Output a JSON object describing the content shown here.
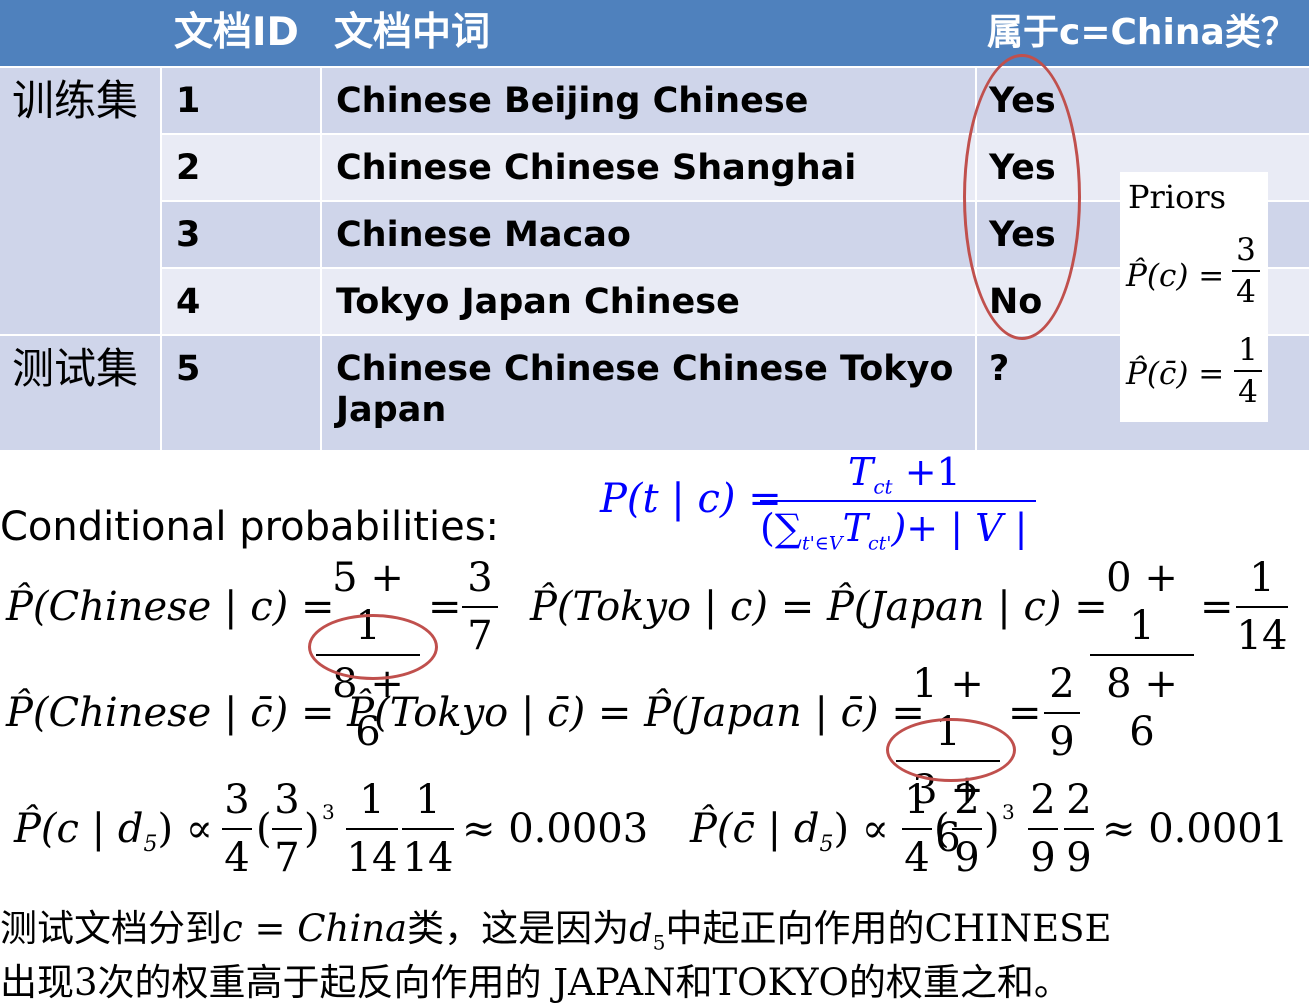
{
  "table": {
    "headers": [
      "文档ID",
      "文档中词",
      "属于c=China类？"
    ],
    "group_train": "训练集",
    "group_test": "测试集",
    "rows": [
      {
        "id": "1",
        "words": "Chinese Beijing Chinese",
        "label": "Yes"
      },
      {
        "id": "2",
        "words": "Chinese Chinese Shanghai",
        "label": "Yes"
      },
      {
        "id": "3",
        "words": "Chinese Macao",
        "label": "Yes"
      },
      {
        "id": "4",
        "words": "Tokyo Japan Chinese",
        "label": "No"
      },
      {
        "id": "5",
        "words": "Chinese Chinese Chinese Tokyo",
        "words_line2": "Japan",
        "label": "?"
      }
    ]
  },
  "priors": {
    "title": "Priors",
    "c_lhs": "P̂(c) =",
    "c_num": "3",
    "c_den": "4",
    "cbar_lhs": "P̂(c̄) =",
    "cbar_num": "1",
    "cbar_den": "4"
  },
  "formula": {
    "lhs": "P(t | c) =",
    "num": "T",
    "num_sub": "ct",
    "num_tail": " +1",
    "den": "(∑",
    "den_sub": "t'∈V",
    "den_mid": "T",
    "den_mid_sub": "ct'",
    "den_tail": ")+ | V |",
    "color": "#0000ff"
  },
  "conditional": {
    "label": "Conditional probabilities:",
    "eq1_lhs": "P̂(Chinese | c) =",
    "eq1_num": "5 + 1",
    "eq1_den": "8 + 6",
    "eq1_eq": "=",
    "eq1_rnum": "3",
    "eq1_rden": "7",
    "eq2_lhs": "P̂(Tokyo | c) = P̂(Japan | c) =",
    "eq2_num": "0 + 1",
    "eq2_den": "8 + 6",
    "eq2_eq": "=",
    "eq2_rnum": "1",
    "eq2_rden": "14",
    "eq3_lhs": "P̂(Chinese | c̄) = P̂(Tokyo | c̄) = P̂(Japan | c̄) =",
    "eq3_num": "1 + 1",
    "eq3_den": "3 + 6",
    "eq3_eq": "=",
    "eq3_rnum": "2",
    "eq3_rden": "9",
    "post_c_lhs": "P̂(c | d",
    "post_c_sub": "5",
    "post_c_mid": ") ∝",
    "post_c_f1": [
      "3",
      "4"
    ],
    "post_c_f2": [
      "3",
      "7"
    ],
    "post_c_exp": "3",
    "post_c_f3": [
      "1",
      "14"
    ],
    "post_c_f4": [
      "1",
      "14"
    ],
    "post_c_result": "≈ 0.0003",
    "post_cbar_lhs": "P̂(c̄ | d",
    "post_cbar_sub": "5",
    "post_cbar_mid": ") ∝",
    "post_cbar_f1": [
      "1",
      "4"
    ],
    "post_cbar_f2": [
      "2",
      "9"
    ],
    "post_cbar_exp": "3",
    "post_cbar_f3": [
      "2",
      "9"
    ],
    "post_cbar_f4": [
      "2",
      "9"
    ],
    "post_cbar_result": "≈ 0.0001"
  },
  "conclusion": {
    "line1_a": "测试文档分到",
    "line1_math": "c = China",
    "line1_b": "类，这是因为",
    "line1_d": "d",
    "line1_sub": "5",
    "line1_c": "中起正向作用的CHINESE",
    "line2": "出现3次的权重高于起反向作用的 JAPAN和TOKYO的权重之和。"
  },
  "accent_color": "#c0504d",
  "header_color": "#4f81bd"
}
